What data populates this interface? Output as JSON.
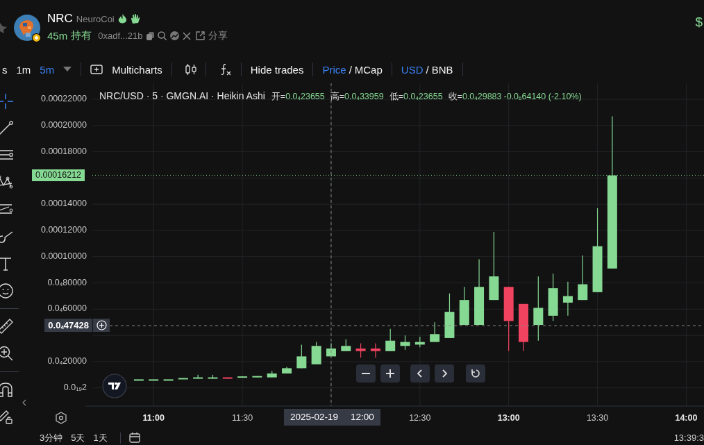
{
  "header": {
    "symbol": "NRC",
    "name": "NeuroCoi",
    "age": "45m",
    "holding": "持有",
    "address": "0xadf...21b",
    "share": "分享",
    "price": "$"
  },
  "toolbar": {
    "intervals": [
      {
        "label": "s",
        "selected": false
      },
      {
        "label": "1m",
        "selected": false
      },
      {
        "label": "5m",
        "selected": true
      }
    ],
    "multicharts": "Multicharts",
    "hide_trades": "Hide trades",
    "toggles": [
      {
        "separator": "/",
        "options": [
          {
            "label": "Price",
            "selected": true
          },
          {
            "label": "MCap",
            "selected": false
          }
        ]
      },
      {
        "separator": "/",
        "options": [
          {
            "label": "USD",
            "selected": true
          },
          {
            "label": "BNB",
            "selected": false
          }
        ]
      }
    ]
  },
  "tool_groups": [
    [
      {
        "kind": "crosshair",
        "selected": true
      },
      {
        "kind": "trend-line",
        "selected": false
      },
      {
        "kind": "horizontal-lines",
        "selected": false
      },
      {
        "kind": "pattern",
        "selected": false
      },
      {
        "kind": "fib",
        "selected": false
      },
      {
        "kind": "brush",
        "selected": false
      },
      {
        "kind": "text",
        "selected": false
      },
      {
        "kind": "emoji",
        "selected": false
      }
    ],
    [
      {
        "kind": "ruler",
        "selected": false
      },
      {
        "kind": "zoom",
        "selected": false
      }
    ],
    [
      {
        "kind": "magnet",
        "selected": false
      },
      {
        "kind": "lock",
        "selected": false
      }
    ]
  ],
  "chart": {
    "legend": {
      "title": "NRC/USD · 5 · GMGN.AI · Heikin Ashi",
      "fields": [
        {
          "label": "开=",
          "value": "0.0$_{4}$23655"
        },
        {
          "label": "高=",
          "value": "0.0$_{4}$33959"
        },
        {
          "label": "低=",
          "value": "0.0$_{4}$23655"
        },
        {
          "label": "收=",
          "value": "0.0$_{4}$29883"
        }
      ],
      "change": "-0.0$_{6}$64140 (-2.10%)"
    },
    "chart_data": {
      "type": "candlestick",
      "grid": true,
      "x": [
        655,
        660,
        665,
        670,
        675,
        680,
        685,
        690,
        695,
        700,
        705,
        710,
        715,
        720,
        725,
        730,
        735,
        740,
        745,
        750,
        755,
        760,
        765,
        770,
        775,
        780,
        785,
        790,
        795,
        800,
        805,
        810,
        815
      ],
      "ohlc": [
        [
          6e-06,
          6e-06,
          6e-06,
          6e-06
        ],
        [
          6e-06,
          6e-06,
          6e-06,
          6e-06
        ],
        [
          6e-06,
          6e-06,
          6e-06,
          6e-06
        ],
        [
          7e-06,
          7e-06,
          7e-06,
          7e-06
        ],
        [
          7e-06,
          1e-05,
          7e-06,
          8e-06
        ],
        [
          7e-06,
          1e-05,
          7e-06,
          8e-06
        ],
        [
          8e-06,
          8e-06,
          7e-06,
          7e-06
        ],
        [
          8e-06,
          9e-06,
          8e-06,
          8.5e-06
        ],
        [
          8e-06,
          9e-06,
          8e-06,
          9e-06
        ],
        [
          8e-06,
          1.3e-05,
          8e-06,
          1.1e-05
        ],
        [
          1.1e-05,
          1.6e-05,
          1.1e-05,
          1.5e-05
        ],
        [
          1.5e-05,
          3.3e-05,
          1.5e-05,
          2.4e-05
        ],
        [
          1.8e-05,
          3.5e-05,
          1.8e-05,
          3.2e-05
        ],
        [
          2.4e-05,
          3.4e-05,
          2.4e-05,
          3e-05
        ],
        [
          2.8e-05,
          3.7e-05,
          2.8e-05,
          3.2e-05
        ],
        [
          3e-05,
          3.4e-05,
          2.3e-05,
          2.8e-05
        ],
        [
          3e-05,
          3.4e-05,
          2.3e-05,
          2.8e-05
        ],
        [
          2.8e-05,
          4.5e-05,
          2.8e-05,
          3.6e-05
        ],
        [
          3.2e-05,
          4e-05,
          2.9e-05,
          3.5e-05
        ],
        [
          3.3e-05,
          3.9e-05,
          3.1e-05,
          3.5e-05
        ],
        [
          3.5e-05,
          5e-05,
          3.5e-05,
          4.1e-05
        ],
        [
          3.8e-05,
          7.2e-05,
          3.8e-05,
          5.8e-05
        ],
        [
          4.8e-05,
          7.7e-05,
          4.8e-05,
          6.7e-05
        ],
        [
          4.8e-05,
          9.8e-05,
          4.8e-05,
          7.7e-05
        ],
        [
          6.7e-05,
          0.000119,
          6.7e-05,
          8.5e-05
        ],
        [
          7.7e-05,
          7.7e-05,
          2.8e-05,
          5.1e-05
        ],
        [
          6.4e-05,
          6.4e-05,
          2.8e-05,
          3.5e-05
        ],
        [
          4.8e-05,
          8.5e-05,
          3.6e-05,
          6.1e-05
        ],
        [
          5.5e-05,
          8.7e-05,
          5.1e-05,
          7.6e-05
        ],
        [
          6.5e-05,
          8.1e-05,
          5.5e-05,
          7e-05
        ],
        [
          6.7e-05,
          0.000101,
          6.7e-05,
          7.9e-05
        ],
        [
          7.3e-05,
          0.000137,
          7.3e-05,
          0.000108
        ],
        [
          9.1e-05,
          0.000207,
          9.1e-05,
          0.000162
        ]
      ],
      "yticks": [
        {
          "value": 0.00022,
          "label": "0.00022000"
        },
        {
          "value": 0.0002,
          "label": "0.00020000"
        },
        {
          "value": 0.00018,
          "label": "0.00018000"
        },
        {
          "value": 0.00014,
          "label": "0.00014000"
        },
        {
          "value": 0.00012,
          "label": "0.00012000"
        },
        {
          "value": 0.0001,
          "label": "0.00010000"
        },
        {
          "value": 8e-05,
          "label": "0.0$_{4}$80000"
        },
        {
          "value": 6e-05,
          "label": "0.0$_{4}$60000"
        },
        {
          "value": 2e-05,
          "label": "0.0$_{4}$20000"
        },
        {
          "value": 2e-20,
          "label": "0.0$_{19}$2"
        }
      ],
      "xticks": [
        {
          "value": 660,
          "label": "11:00"
        },
        {
          "value": 690,
          "label": "11:30"
        },
        {
          "value": 750,
          "label": "12:30"
        },
        {
          "value": 780,
          "label": "13:00"
        },
        {
          "value": 810,
          "label": "13:30"
        },
        {
          "value": 840,
          "label": "14:00"
        }
      ],
      "xlim": [
        639.3,
        846
      ],
      "ylim": [
        -1.39e-05,
        0.0002322
      ],
      "ref_lines": [
        {
          "axis": "y",
          "value": 0.00016212,
          "label": "0.00016212",
          "color": "#86d993"
        },
        {
          "axis": "y",
          "value": 4.7428e-05,
          "label": "0.0$_{4}$47428",
          "color": "#888888"
        },
        {
          "axis": "x",
          "value": 720,
          "color": "#888888"
        }
      ]
    },
    "crosshair_time": {
      "date": "2025-02-19",
      "time": "12:00"
    }
  },
  "bottom": {
    "ranges": [
      {
        "label": "3分钟"
      },
      {
        "label": "5天"
      },
      {
        "label": "1天"
      }
    ],
    "clock": "13:39:3"
  }
}
